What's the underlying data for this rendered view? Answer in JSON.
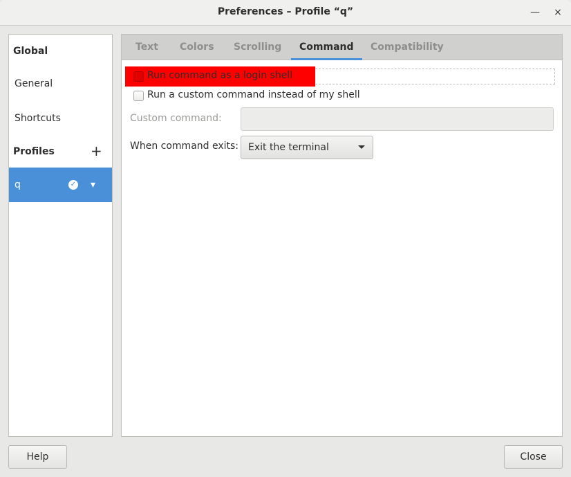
{
  "window": {
    "title": "Preferences – Profile “q”",
    "minimize": "—",
    "close": "×"
  },
  "sidebar": {
    "global": "Global",
    "general": "General",
    "shortcuts": "Shortcuts",
    "profiles": "Profiles",
    "add": "+",
    "profile": "q",
    "default_icon": "check-circle",
    "menu": "▾"
  },
  "tabs": [
    "Text",
    "Colors",
    "Scrolling",
    "Command",
    "Compatibility"
  ],
  "active_tab": "Command",
  "command": {
    "login_shell": {
      "label": "Run command as a login shell",
      "checked": false
    },
    "custom": {
      "label": "Run a custom command instead of my shell",
      "checked": false
    },
    "custom_command_label": "Custom command:",
    "custom_command_value": "",
    "exit_label": "When command exits:",
    "exit_value": "Exit the terminal"
  },
  "highlight_color": "#ff0000",
  "buttons": {
    "help": "Help",
    "close": "Close"
  }
}
